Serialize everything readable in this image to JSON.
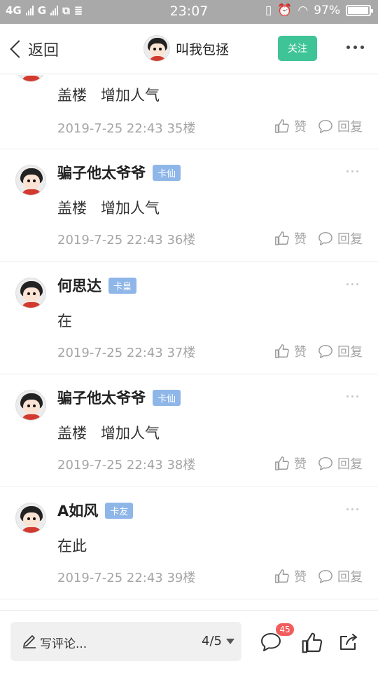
{
  "status_bar": {
    "network1": "4G",
    "network2": "G",
    "time": "23:07",
    "battery": "97%",
    "battery_level": 0.97
  },
  "nav": {
    "back_label": "返回",
    "title_user": "叫我包拯",
    "follow_label": "关注"
  },
  "posts": [
    {
      "user": "",
      "badge": "",
      "content": "盖楼   增加人气",
      "date": "2019-7-25 22:43",
      "floor": "35楼",
      "like_label": "赞",
      "reply_label": "回复"
    },
    {
      "user": "骗子他太爷爷",
      "badge": "卡仙",
      "content": "盖楼   增加人气",
      "date": "2019-7-25 22:43",
      "floor": "36楼",
      "like_label": "赞",
      "reply_label": "回复"
    },
    {
      "user": "何思达",
      "badge": "卡皇",
      "content": "在",
      "date": "2019-7-25 22:43",
      "floor": "37楼",
      "like_label": "赞",
      "reply_label": "回复"
    },
    {
      "user": "骗子他太爷爷",
      "badge": "卡仙",
      "content": "盖楼   增加人气",
      "date": "2019-7-25 22:43",
      "floor": "38楼",
      "like_label": "赞",
      "reply_label": "回复"
    },
    {
      "user": "A如风",
      "badge": "卡友",
      "content": "在此",
      "date": "2019-7-25 22:43",
      "floor": "39楼",
      "like_label": "赞",
      "reply_label": "回复"
    }
  ],
  "bottom": {
    "comment_placeholder": "写评论...",
    "page_indicator": "4/5",
    "comment_count": "45"
  },
  "colors": {
    "accent_green": "#3ec496",
    "badge_blue": "#8fb6e8",
    "count_red": "#f25c5c"
  }
}
